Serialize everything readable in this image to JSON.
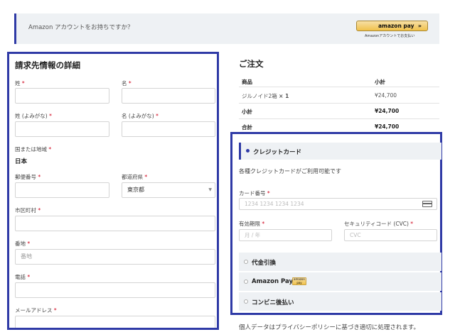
{
  "amazon": {
    "message": "Amazon アカウントをお持ちですか？",
    "button_label": "amazon pay",
    "button_arrow": "»",
    "button_sub": "Amazonアカウントでお支払い"
  },
  "billing": {
    "title": "請求先情報の詳細",
    "required_mark": "*",
    "last_name_label": "姓",
    "first_name_label": "名",
    "last_kana_label": "姓 (よみがな)",
    "first_kana_label": "名 (よみがな)",
    "country_label": "国または地域",
    "country_value": "日本",
    "postcode_label": "郵便番号",
    "prefecture_label": "都道府県",
    "prefecture_value": "東京都",
    "city_label": "市区町村",
    "address_label": "番地",
    "address_placeholder": "番地",
    "phone_label": "電話",
    "email_label": "メールアドレス"
  },
  "order": {
    "title": "ご注文",
    "col_product": "商品",
    "col_subtotal": "小計",
    "rows": [
      {
        "product": "ジルノイド2箱",
        "qty": "× 1",
        "amount": "¥24,700"
      }
    ],
    "subtotal_label": "小計",
    "subtotal_value": "¥24,700",
    "total_label": "合計",
    "total_value": "¥24,700"
  },
  "payment": {
    "selected_method": "クレジットカード",
    "description": "各種クレジットカードがご利用可能です",
    "card_number_label": "カード番号",
    "card_number_placeholder": "1234 1234 1234 1234",
    "expiry_label": "有効期限",
    "expiry_placeholder": "月 / 年",
    "cvc_label": "セキュリティコード (CVC)",
    "cvc_placeholder": "CVC",
    "options": [
      {
        "label": "代金引換"
      },
      {
        "label": "Amazon Pay",
        "badge": "amazon pay"
      },
      {
        "label": "コンビニ後払い"
      }
    ]
  },
  "privacy_text": "個人データはプライバシーポリシーに基づき適切に処理されます。"
}
